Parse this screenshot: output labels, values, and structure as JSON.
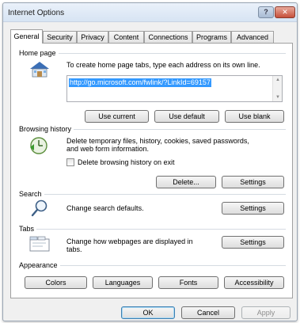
{
  "window": {
    "title": "Internet Options",
    "help_glyph": "?",
    "close_glyph": "✕"
  },
  "tabs": [
    "General",
    "Security",
    "Privacy",
    "Content",
    "Connections",
    "Programs",
    "Advanced"
  ],
  "home_page": {
    "label": "Home page",
    "description": "To create home page tabs, type each address on its own line.",
    "url": "http://go.microsoft.com/fwlink/?LinkId=69157",
    "buttons": {
      "use_current": "Use current",
      "use_default": "Use default",
      "use_blank": "Use blank"
    }
  },
  "browsing_history": {
    "label": "Browsing history",
    "description_1": "Delete temporary files, history, cookies, saved passwords,",
    "description_2": "and web form information.",
    "checkbox_label": "Delete browsing history on exit",
    "checkbox_checked": false,
    "buttons": {
      "delete": "Delete...",
      "settings": "Settings"
    }
  },
  "search": {
    "label": "Search",
    "description": "Change search defaults.",
    "buttons": {
      "settings": "Settings"
    }
  },
  "tabs_section": {
    "label": "Tabs",
    "description_1": "Change how webpages are displayed in",
    "description_2": "tabs.",
    "buttons": {
      "settings": "Settings"
    }
  },
  "appearance": {
    "label": "Appearance",
    "buttons": {
      "colors": "Colors",
      "languages": "Languages",
      "fonts": "Fonts",
      "accessibility": "Accessibility"
    }
  },
  "footer": {
    "ok": "OK",
    "cancel": "Cancel",
    "apply": "Apply"
  },
  "colors": {
    "selection": "#3399ff",
    "close_button": "#c6503a",
    "titlebar": "#d7e4f3"
  }
}
